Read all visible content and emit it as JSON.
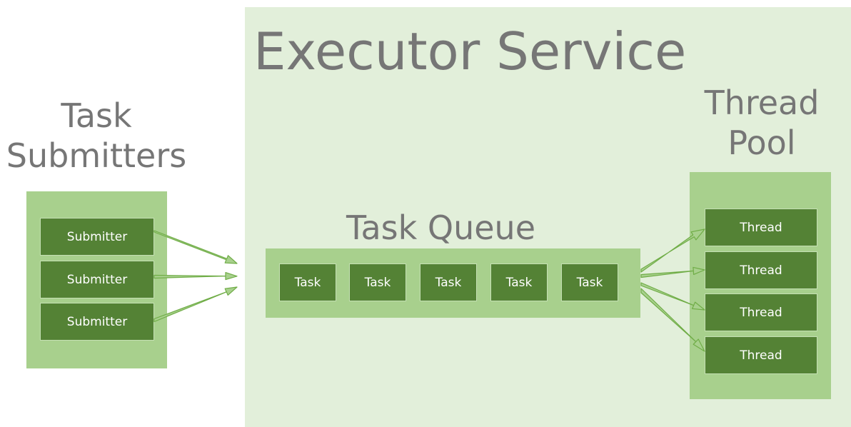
{
  "titles": {
    "executor_service": "Executor Service",
    "task_submitters_line1": "Task",
    "task_submitters_line2": "Submitters",
    "thread_pool_line1": "Thread",
    "thread_pool_line2": "Pool",
    "task_queue": "Task Queue"
  },
  "submitters": [
    "Submitter",
    "Submitter",
    "Submitter"
  ],
  "tasks": [
    "Task",
    "Task",
    "Task",
    "Task",
    "Task"
  ],
  "threads": [
    "Thread",
    "Thread",
    "Thread",
    "Thread"
  ],
  "colors": {
    "executor_background": "#e2efda",
    "panel_light_green": "#a8d08d",
    "box_dark_green": "#548235",
    "box_text": "#ffffff",
    "heading_text": "#767676"
  }
}
